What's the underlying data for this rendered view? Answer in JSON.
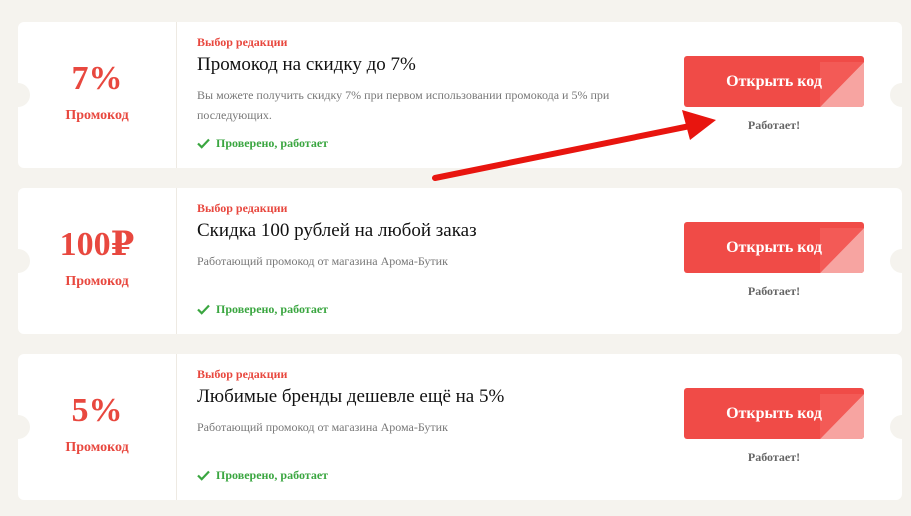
{
  "offers": [
    {
      "amount": "7%",
      "amount_label": "Промокод",
      "editor_pick": "Выбор редакции",
      "title": "Промокод на скидку до 7%",
      "description": "Вы можете получить скидку 7% при первом использовании промокода и 5% при последующих.",
      "verified": "Проверено, работает",
      "button": "Открыть код",
      "status": "Работает!"
    },
    {
      "amount": "100₽",
      "amount_label": "Промокод",
      "editor_pick": "Выбор редакции",
      "title": "Скидка 100 рублей на любой заказ",
      "description": "Работающий промокод от магазина Арома-Бутик",
      "verified": "Проверено, работает",
      "button": "Открыть код",
      "status": "Работает!"
    },
    {
      "amount": "5%",
      "amount_label": "Промокод",
      "editor_pick": "Выбор редакции",
      "title": "Любимые бренды дешевле ещё на 5%",
      "description": "Работающий промокод от магазина Арома-Бутик",
      "verified": "Проверено, работает",
      "button": "Открыть код",
      "status": "Работает!"
    }
  ],
  "colors": {
    "accent": "#e8483f",
    "button": "#f04b47",
    "verified": "#3aa640",
    "annotation_arrow": "#e8150f"
  },
  "icons": {
    "verified": "check-icon",
    "annotation": "red-arrow-annotation"
  }
}
